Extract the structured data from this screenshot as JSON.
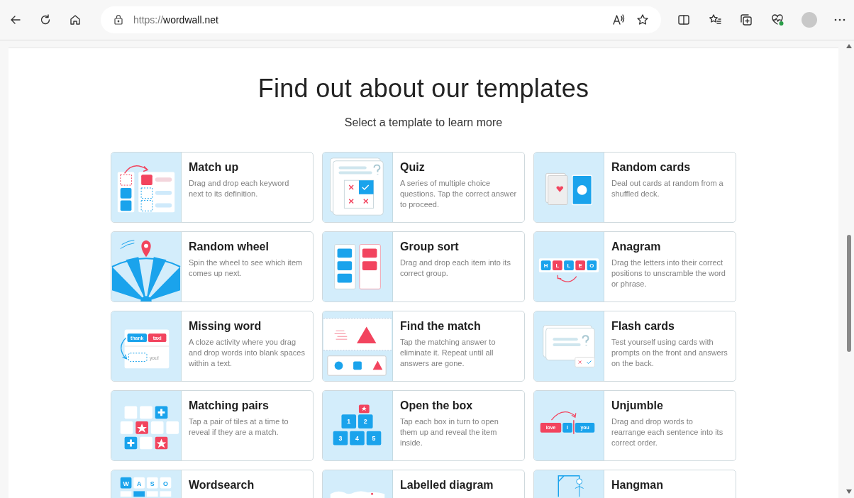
{
  "browser": {
    "url": {
      "scheme": "https://",
      "host": "wordwall.net"
    }
  },
  "heading": "Find out about our templates",
  "subheading": "Select a template to learn more",
  "templates": [
    {
      "kind": "match-up",
      "title": "Match up",
      "description": "Drag and drop each keyword next to its definition."
    },
    {
      "kind": "quiz",
      "title": "Quiz",
      "description": "A series of multiple choice questions. Tap the correct answer to proceed."
    },
    {
      "kind": "random-cards",
      "title": "Random cards",
      "description": "Deal out cards at random from a shuffled deck."
    },
    {
      "kind": "random-wheel",
      "title": "Random wheel",
      "description": "Spin the wheel to see which item comes up next."
    },
    {
      "kind": "group-sort",
      "title": "Group sort",
      "description": "Drag and drop each item into its correct group."
    },
    {
      "kind": "anagram",
      "title": "Anagram",
      "description": "Drag the letters into their correct positions to unscramble the word or phrase.",
      "art_text": [
        "H",
        "L",
        "L",
        "E",
        "O"
      ]
    },
    {
      "kind": "missing-word",
      "title": "Missing word",
      "description": "A cloze activity where you drag and drop words into blank spaces within a text.",
      "art_text": [
        "thank",
        "taxi",
        "you!"
      ]
    },
    {
      "kind": "find-match",
      "title": "Find the match",
      "description": "Tap the matching answer to eliminate it. Repeat until all answers are gone."
    },
    {
      "kind": "flash-cards",
      "title": "Flash cards",
      "description": "Test yourself using cards with prompts on the front and answers on the back."
    },
    {
      "kind": "matching-pairs",
      "title": "Matching pairs",
      "description": "Tap a pair of tiles at a time to reveal if they are a match."
    },
    {
      "kind": "open-box",
      "title": "Open the box",
      "description": "Tap each box in turn to open them up and reveal the item inside.",
      "art_text": [
        "1",
        "2",
        "3",
        "4",
        "5"
      ]
    },
    {
      "kind": "unjumble",
      "title": "Unjumble",
      "description": "Drag and drop words to rearrange each sentence into its correct order.",
      "art_text": [
        "love",
        "I",
        "you"
      ]
    },
    {
      "kind": "wordsearch",
      "title": "Wordsearch",
      "art_text": [
        "W",
        "A",
        "S",
        "O"
      ]
    },
    {
      "kind": "labelled-diagram",
      "title": "Labelled diagram"
    },
    {
      "kind": "hangman",
      "title": "Hangman"
    }
  ]
}
